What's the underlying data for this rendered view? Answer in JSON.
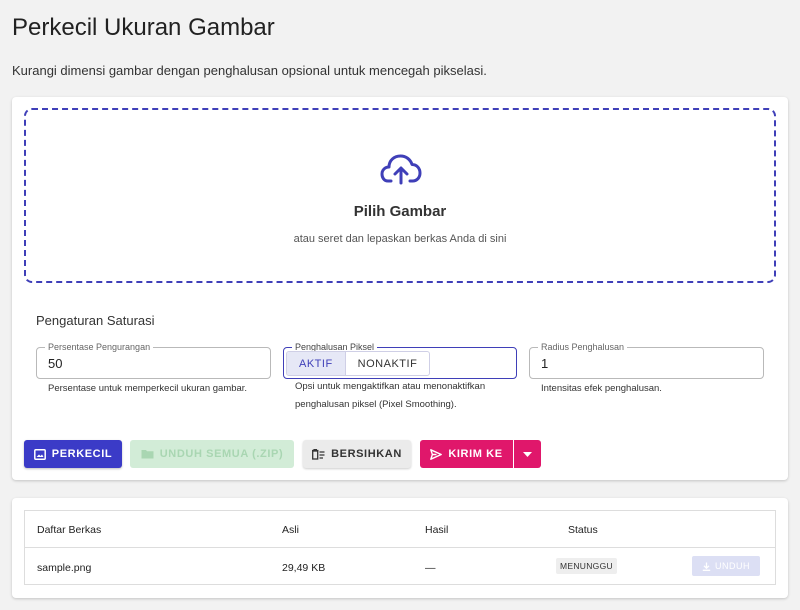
{
  "page": {
    "title": "Perkecil Ukuran Gambar",
    "subtitle": "Kurangi dimensi gambar dengan penghalusan opsional untuk mencegah pikselasi."
  },
  "dropzone": {
    "icon": "cloud-upload-icon",
    "title": "Pilih Gambar",
    "hint": "atau seret dan lepaskan berkas Anda di sini"
  },
  "settings": {
    "title": "Pengaturan Saturasi",
    "percent": {
      "label": "Persentase Pengurangan",
      "value": "50",
      "help": "Persentase untuk memperkecil ukuran gambar."
    },
    "smoothing": {
      "label": "Penghalusan Piksel",
      "on_label": "AKTIF",
      "off_label": "NONAKTIF",
      "selected": "AKTIF",
      "help": "Opsi untuk mengaktifkan atau menonaktifkan penghalusan piksel (Pixel Smoothing)."
    },
    "radius": {
      "label": "Radius Penghalusan",
      "value": "1",
      "help": "Intensitas efek penghalusan."
    }
  },
  "actions": {
    "shrink_label": "PERKECIL",
    "download_all_label": "UNDUH SEMUA (.ZIP)",
    "clear_label": "BERSIHKAN",
    "send_label": "KIRIM KE"
  },
  "table": {
    "headers": [
      "Daftar Berkas",
      "Asli",
      "Hasil",
      "Status"
    ],
    "rows": [
      {
        "name": "sample.png",
        "original": "29,49 KB",
        "result": "—",
        "status": "MENUNGGU",
        "download_label": "UNDUH"
      }
    ]
  },
  "colors": {
    "accent": "#3b3bc7",
    "send": "#e0176b",
    "disabled_green": "#d2ecd7"
  }
}
